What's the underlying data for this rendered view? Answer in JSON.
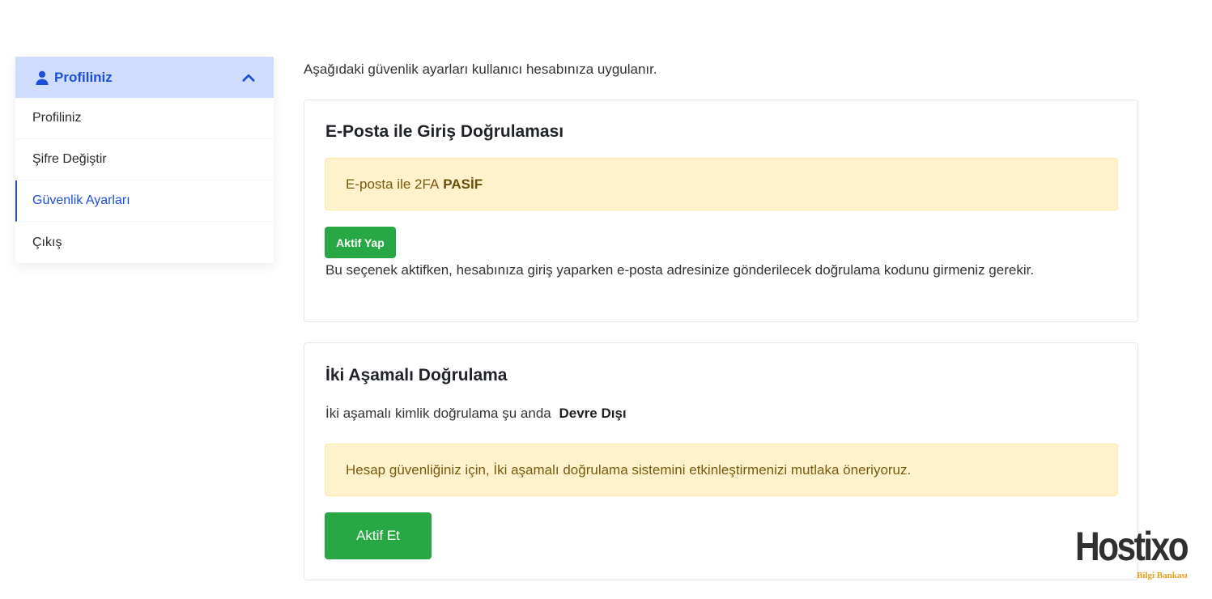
{
  "sidebar": {
    "header_label": "Profiliniz",
    "items": [
      {
        "label": "Profiliniz"
      },
      {
        "label": "Şifre Değiştir"
      },
      {
        "label": "Güvenlik Ayarları"
      },
      {
        "label": "Çıkış"
      }
    ]
  },
  "main": {
    "intro": "Aşağıdaki güvenlik ayarları kullanıcı hesabınıza uygulanır.",
    "email_2fa": {
      "title": "E-Posta ile Giriş Doğrulaması",
      "alert_text": "E-posta ile 2FA",
      "alert_status": "PASİF",
      "button_label": "Aktif Yap",
      "description": "Bu seçenek aktifken, hesabınıza giriş yaparken e-posta adresinize gönderilecek doğrulama kodunu girmeniz gerekir."
    },
    "two_factor": {
      "title": "İki Aşamalı Doğrulama",
      "status_text": "İki aşamalı kimlik doğrulama şu anda",
      "status_value": "Devre Dışı",
      "alert_text": "Hesap güvenliğiniz için, İki aşamalı doğrulama sistemini etkinleştirmenizi mutlaka öneriyoruz.",
      "button_label": "Aktif Et"
    }
  },
  "logo": {
    "word": "Hostixo",
    "sub": "Bilgi Bankası"
  },
  "colors": {
    "accent": "#1d4ed8",
    "success": "#28a745",
    "warning_bg": "#fff2cd"
  },
  "icons": {
    "header": "user-icon",
    "toggle": "chevron-up-icon"
  }
}
